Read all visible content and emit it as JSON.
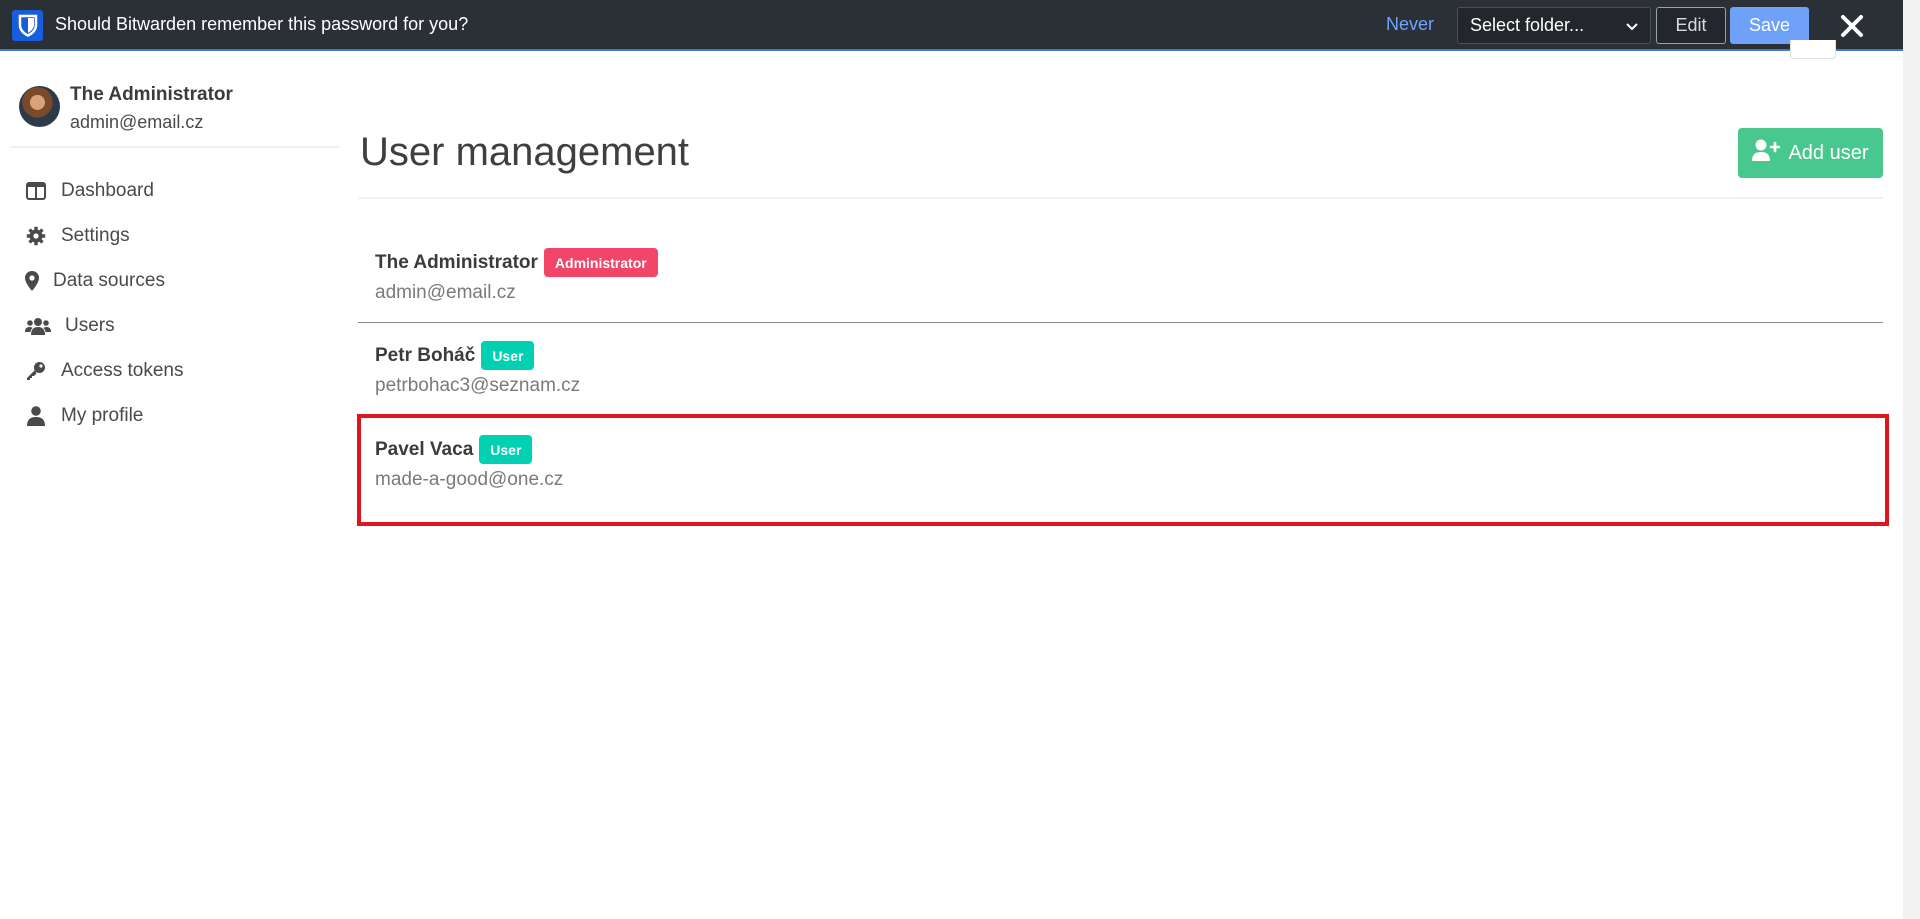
{
  "bitwarden": {
    "message": "Should Bitwarden remember this password for you?",
    "never_label": "Never",
    "folder_select_value": "Select folder...",
    "edit_label": "Edit",
    "save_label": "Save",
    "accent_color": "#175ddc"
  },
  "sidebar": {
    "user": {
      "name": "The Administrator",
      "email": "admin@email.cz"
    },
    "items": [
      {
        "label": "Dashboard",
        "icon": "columns-icon"
      },
      {
        "label": "Settings",
        "icon": "gear-icon"
      },
      {
        "label": "Data sources",
        "icon": "map-marker-icon"
      },
      {
        "label": "Users",
        "icon": "users-icon"
      },
      {
        "label": "Access tokens",
        "icon": "key-icon"
      },
      {
        "label": "My profile",
        "icon": "user-icon"
      }
    ]
  },
  "main": {
    "title": "User management",
    "add_user_label": "Add user",
    "users": [
      {
        "name": "The Administrator",
        "role": "Administrator",
        "email": "admin@email.cz"
      },
      {
        "name": "Petr Boháč",
        "role": "User",
        "email": "petrbohac3@seznam.cz"
      },
      {
        "name": "Pavel Vaca",
        "role": "User",
        "email": "made-a-good@one.cz"
      }
    ]
  },
  "colors": {
    "success": "#48c78e",
    "danger": "#f14668",
    "primary": "#00d1b2",
    "highlight": "#e0141e"
  }
}
